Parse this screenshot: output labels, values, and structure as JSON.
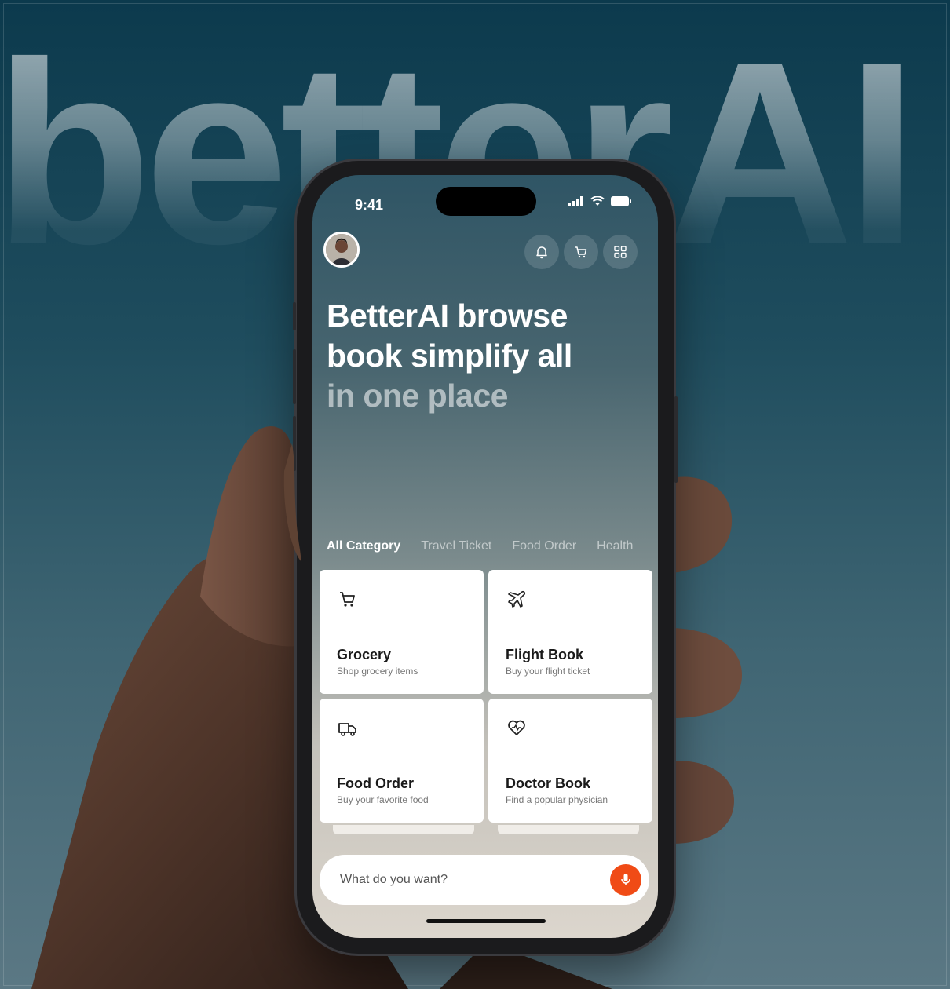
{
  "background_word": "betterAI",
  "status_bar": {
    "time": "9:41"
  },
  "header": {
    "avatar_alt": "user avatar",
    "actions": [
      "bell-icon",
      "cart-icon",
      "grid-icon"
    ]
  },
  "headline": {
    "line1": "BetterAI browse",
    "line2": "book simplify all",
    "line3": "in one place"
  },
  "tabs": [
    {
      "label": "All Category",
      "active": true
    },
    {
      "label": "Travel Ticket",
      "active": false
    },
    {
      "label": "Food Order",
      "active": false
    },
    {
      "label": "Health",
      "active": false
    }
  ],
  "cards": [
    {
      "icon": "cart-icon",
      "title": "Grocery",
      "subtitle": "Shop grocery items"
    },
    {
      "icon": "airplane-icon",
      "title": "Flight Book",
      "subtitle": "Buy your flight ticket"
    },
    {
      "icon": "truck-icon",
      "title": "Food Order",
      "subtitle": "Buy your favorite food"
    },
    {
      "icon": "heart-icon",
      "title": "Doctor Book",
      "subtitle": "Find a popular physician"
    }
  ],
  "search": {
    "placeholder": "What do you want?"
  },
  "colors": {
    "accent": "#f04b16",
    "background_top": "#0c3a4d",
    "background_bottom": "#5b7884"
  }
}
